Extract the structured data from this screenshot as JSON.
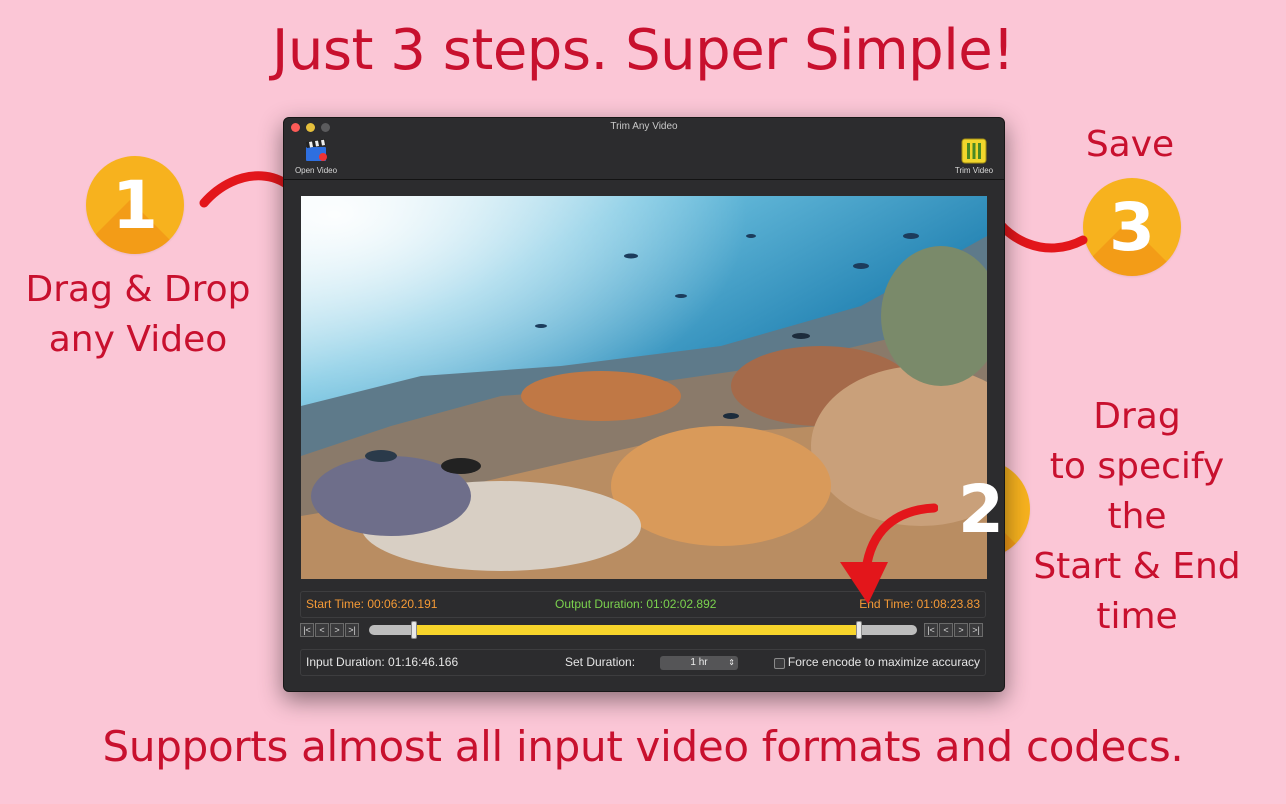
{
  "headline": "Just 3 steps. Super Simple!",
  "footer": "Supports almost all input video formats and codecs.",
  "steps": [
    {
      "number": "1",
      "lines": [
        "Drag & Drop",
        "any Video"
      ]
    },
    {
      "number": "2",
      "lines": [
        "Drag",
        "to specify",
        "the",
        "Start & End",
        "time"
      ]
    },
    {
      "number": "3",
      "lines": [
        "Save"
      ]
    }
  ],
  "window": {
    "title": "Trim Any Video",
    "toolbar": {
      "open_label": "Open Video",
      "open_icon": "clapperboard-icon",
      "trim_label": "Trim Video",
      "trim_icon": "trim-film-icon"
    },
    "times": {
      "start": "Start Time: 00:06:20.191",
      "output": "Output Duration: 01:02:02.892",
      "end": "End Time: 01:08:23.83"
    },
    "trim_range": {
      "start_fraction": 0.083,
      "end_fraction": 0.894
    },
    "stepper_glyphs": [
      "|<",
      "<",
      ">",
      ">|"
    ],
    "bottom": {
      "input_duration": "Input Duration: 01:16:46.166",
      "set_duration_label": "Set Duration:",
      "set_duration_value": "1 hr",
      "force_encode": "Force encode to maximize accuracy"
    },
    "colors": {
      "start": "#f59a36",
      "output": "#7bd24e",
      "end": "#f59a36",
      "range": "#f7d42b"
    }
  }
}
